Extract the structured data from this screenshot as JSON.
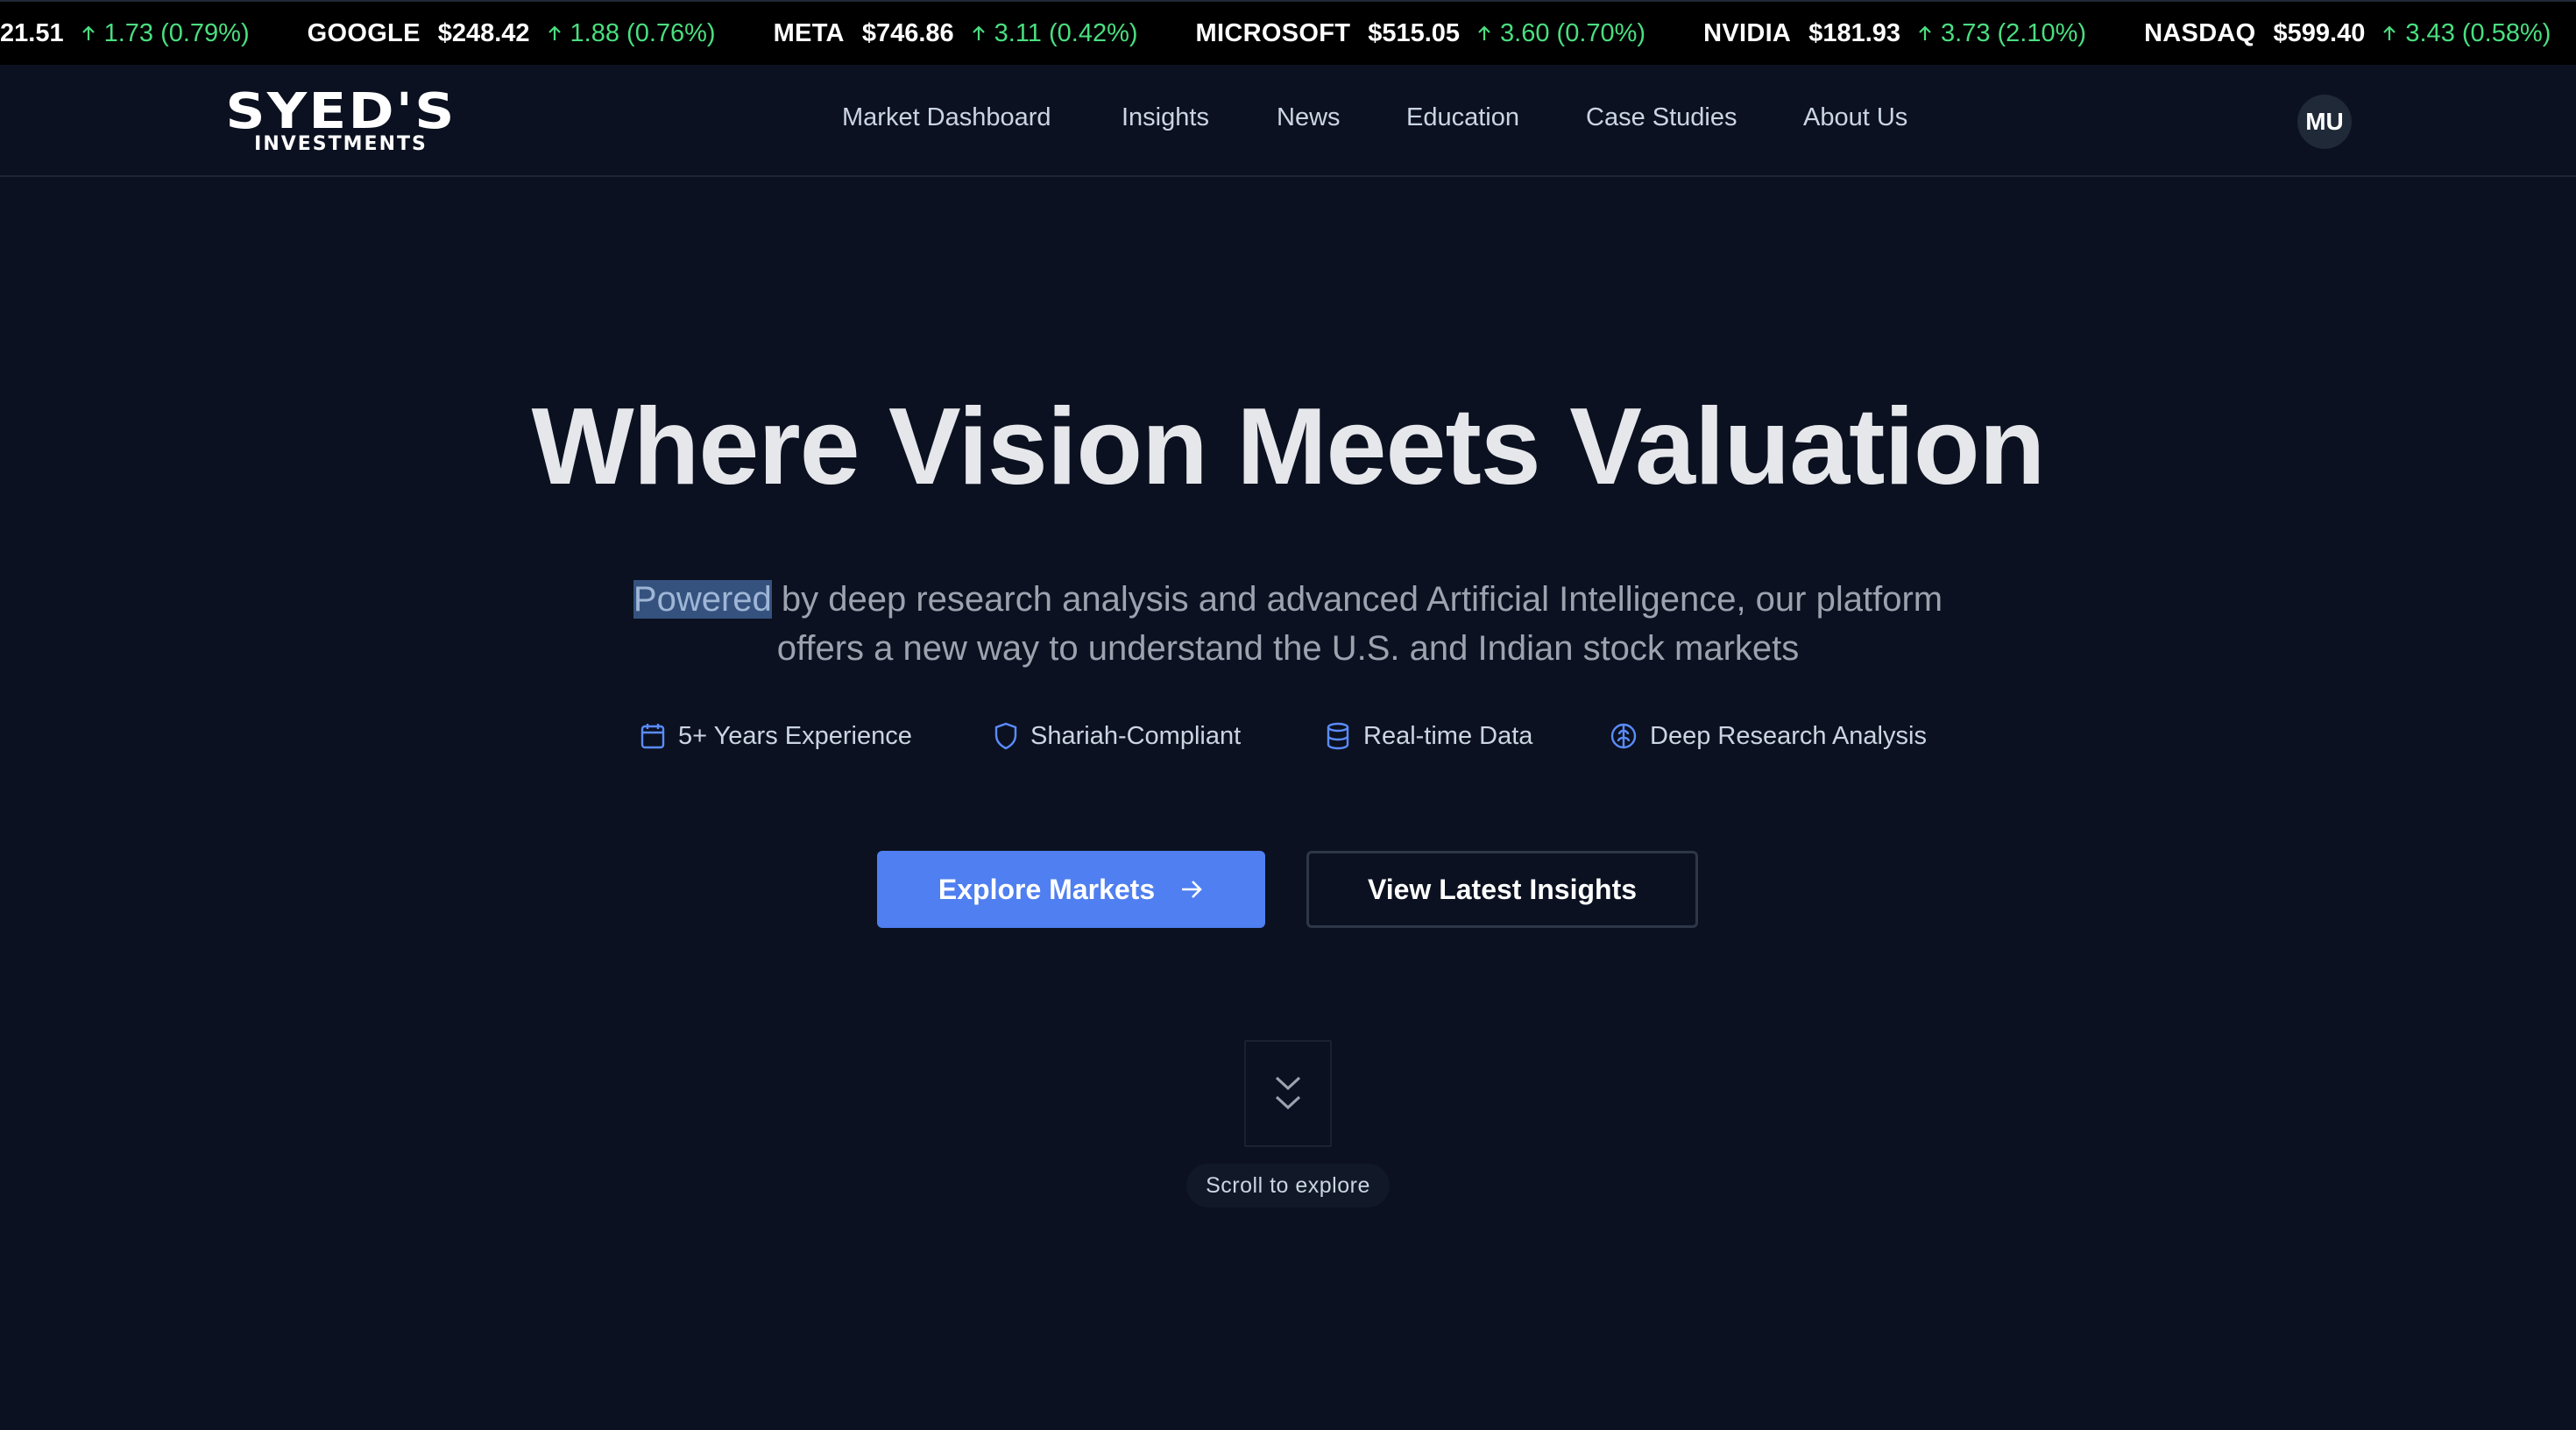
{
  "ticker": [
    {
      "symbol": "",
      "price": "21.51",
      "change": "1.73 (0.79%)"
    },
    {
      "symbol": "GOOGLE",
      "price": "$248.42",
      "change": "1.88 (0.76%)"
    },
    {
      "symbol": "META",
      "price": "$746.86",
      "change": "3.11 (0.42%)"
    },
    {
      "symbol": "MICROSOFT",
      "price": "$515.05",
      "change": "3.60 (0.70%)"
    },
    {
      "symbol": "NVIDIA",
      "price": "$181.93",
      "change": "3.73 (2.10%)"
    },
    {
      "symbol": "NASDAQ",
      "price": "$599.40",
      "change": "3.43 (0.58%)"
    }
  ],
  "brand": {
    "logo_top": "SYED'S",
    "logo_bottom": "INVESTMENTS"
  },
  "nav": {
    "links": [
      "Market Dashboard",
      "Insights",
      "News",
      "Education",
      "Case Studies",
      "About Us"
    ],
    "avatar_initials": "MU"
  },
  "hero": {
    "title": "Where Vision Meets Valuation",
    "subtitle_highlighted": "Powered",
    "subtitle_rest": " by deep research analysis and advanced Artificial Intelligence, our platform offers a new way to understand the U.S. and Indian stock markets"
  },
  "features": [
    {
      "icon": "calendar-icon",
      "label": "5+ Years Experience"
    },
    {
      "icon": "shield-icon",
      "label": "Shariah-Compliant"
    },
    {
      "icon": "database-icon",
      "label": "Real-time Data"
    },
    {
      "icon": "brain-icon",
      "label": "Deep Research Analysis"
    }
  ],
  "cta": {
    "primary": "Explore Markets",
    "secondary": "View Latest Insights"
  },
  "scroll_hint": "Scroll to explore",
  "colors": {
    "background": "#0b1120",
    "accent": "#4f7ff0",
    "positive": "#4ade80",
    "highlight": "#35527f"
  }
}
